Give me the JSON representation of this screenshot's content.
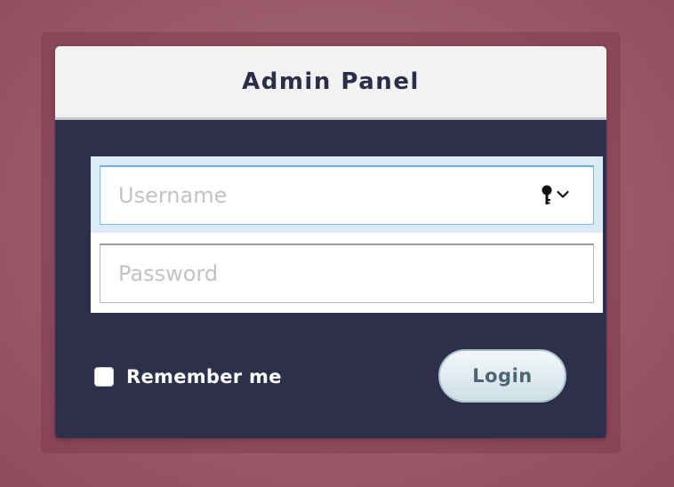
{
  "header": {
    "title": "Admin Panel"
  },
  "form": {
    "username": {
      "placeholder": "Username",
      "value": ""
    },
    "password": {
      "placeholder": "Password",
      "value": ""
    },
    "remember_me": {
      "label": "Remember me",
      "checked": false
    },
    "login_label": "Login"
  },
  "icons": {
    "password_manager": "key-icon",
    "dropdown": "chevron-down-icon"
  },
  "colors": {
    "background": "#9a5b6c",
    "panel_body": "#2e2f4b",
    "panel_header": "#f2f2f2",
    "title_text": "#2c2d48",
    "focus_ring": "#dcebf7",
    "button_text": "#4d6572"
  }
}
